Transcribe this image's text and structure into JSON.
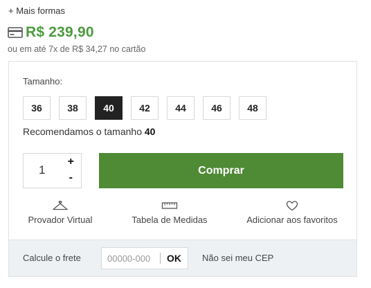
{
  "more_forms": "+ Mais formas",
  "price": {
    "icon": "credit-card-icon",
    "value": "R$ 239,90",
    "color": "#4c9b3d",
    "installments": "ou em até 7x de R$ 34,27 no cartão"
  },
  "size_selector": {
    "label": "Tamanho:",
    "options": [
      "36",
      "38",
      "40",
      "42",
      "44",
      "46",
      "48"
    ],
    "selected": "40",
    "recommend_text": "Recomendamos o tamanho ",
    "recommend_size": "40"
  },
  "quantity": {
    "value": "1",
    "plus": "+",
    "minus": "-"
  },
  "buy_button": {
    "label": "Comprar",
    "color": "#4f8a35"
  },
  "actions": [
    {
      "icon": "hanger-icon",
      "label": "Provador Virtual"
    },
    {
      "icon": "ruler-icon",
      "label": "Tabela de Medidas"
    },
    {
      "icon": "heart-icon",
      "label": "Adicionar aos favoritos"
    }
  ],
  "shipping": {
    "label": "Calcule o frete",
    "placeholder": "00000-000",
    "ok_label": "OK",
    "no_cep_label": "Não sei meu CEP"
  }
}
